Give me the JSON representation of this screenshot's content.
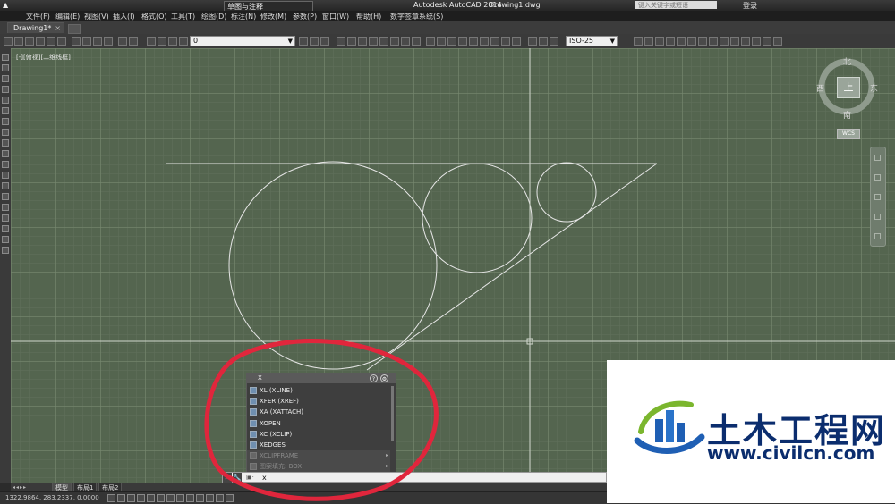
{
  "titlebar": {
    "workspace": "草图与注释",
    "app_title": "Autodesk AutoCAD 2014",
    "file_name": "Drawing1.dwg",
    "search_placeholder": "键入关键字或短语",
    "login": "登录"
  },
  "menu": [
    "文件(F)",
    "编辑(E)",
    "视图(V)",
    "插入(I)",
    "格式(O)",
    "工具(T)",
    "绘图(D)",
    "标注(N)",
    "修改(M)",
    "参数(P)",
    "窗口(W)",
    "帮助(H)",
    "数字签章系统(S)"
  ],
  "tabs": {
    "active": "Drawing1*",
    "close": "×"
  },
  "toolbar": {
    "layer_value": "0",
    "dimstyle_value": "ISO-25"
  },
  "viewport": {
    "label": "[-][俯视][二维线框]",
    "compass": {
      "north": "北",
      "south": "南",
      "east": "东",
      "west": "西",
      "top": "上"
    },
    "wcs": "WCS"
  },
  "autocomplete": {
    "title": "X",
    "items": [
      {
        "label": "XL (XLINE)",
        "dim": false
      },
      {
        "label": "XFER (XREF)",
        "dim": false
      },
      {
        "label": "XA (XATTACH)",
        "dim": false
      },
      {
        "label": "XOPEN",
        "dim": false
      },
      {
        "label": "XC (XCLIP)",
        "dim": false
      },
      {
        "label": "XEDGES",
        "dim": false
      },
      {
        "label": "XCLIPFRAME",
        "dim": true
      },
      {
        "label": "图案填充: BOX",
        "dim": true
      }
    ]
  },
  "command_line": {
    "prompt": "▣·",
    "text": "x"
  },
  "layout_tabs": [
    "模型",
    "布局1",
    "布局2"
  ],
  "status": {
    "coords": "1322.9864, 283.2337, 0.0000"
  },
  "watermark": {
    "text": "土木工程网",
    "url": "www.civilcn.com"
  },
  "colors": {
    "annotation_circle": "#e0263c",
    "watermark_text": "#0b2d6e",
    "viewport_bg": "#54654f"
  }
}
